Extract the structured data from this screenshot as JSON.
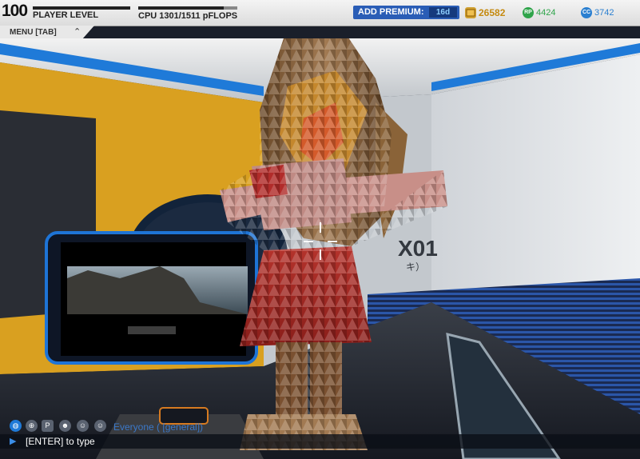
{
  "hud": {
    "player_level": "100",
    "player_level_label": "PLAYER LEVEL",
    "cpu_label": "CPU 1301/1511 pFLOPS",
    "cpu_used": 1301,
    "cpu_max": 1511,
    "premium_label": "ADD PREMIUM:",
    "premium_days": "16d",
    "robits": "26582",
    "rp_icon_text": "RP",
    "rp": "4424",
    "cc_icon_text": "CC",
    "cosmetic_credits": "3742"
  },
  "menu": {
    "label": "MENU [TAB]"
  },
  "scene": {
    "wall_sign_text": "X01",
    "wall_sign_sub": "キ）"
  },
  "chat": {
    "channel": "Everyone ( [general])",
    "prompt": "[ENTER] to type",
    "icons": [
      "globe-icon",
      "target-icon",
      "p-icon",
      "party-icon",
      "friend-icon",
      "user-icon"
    ]
  },
  "colors": {
    "accent_blue": "#2a5db6",
    "robit_gold": "#c58a10",
    "rp_green": "#2fa44a",
    "cc_blue": "#2a7fd0",
    "wall_orange": "#d9a020"
  }
}
